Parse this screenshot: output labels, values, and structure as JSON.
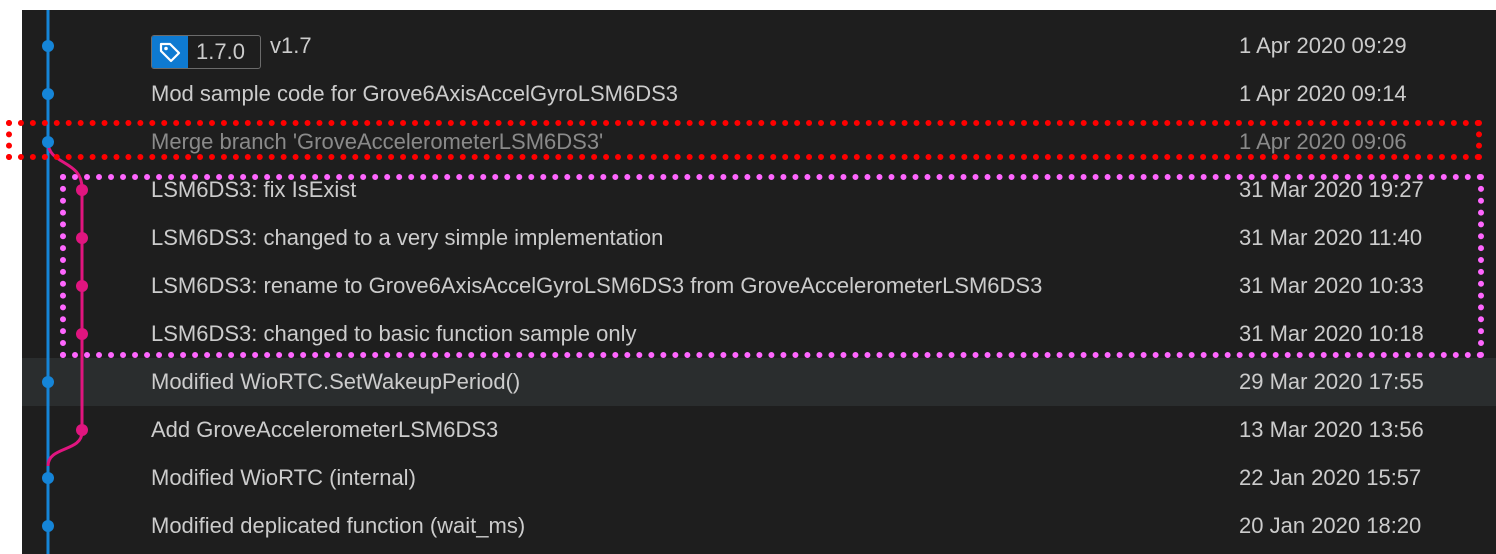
{
  "tag": {
    "name": "1.7.0",
    "label": "v1.7",
    "icon": "tag-icon"
  },
  "colors": {
    "main_branch": "#1585d8",
    "feature_branch": "#e0157f",
    "highlight_red": "#ff0000",
    "highlight_pink": "#ff66ff"
  },
  "commits": [
    {
      "message": "",
      "date": "1 Apr 2020 09:29"
    },
    {
      "message": "Mod sample code for Grove6AxisAccelGyroLSM6DS3",
      "date": "1 Apr 2020 09:14"
    },
    {
      "message": "Merge branch 'GroveAccelerometerLSM6DS3'",
      "date": "1 Apr 2020 09:06"
    },
    {
      "message": "LSM6DS3: fix IsExist",
      "date": "31 Mar 2020 19:27"
    },
    {
      "message": "LSM6DS3: changed to a very simple implementation",
      "date": "31 Mar 2020 11:40"
    },
    {
      "message": "LSM6DS3: rename to Grove6AxisAccelGyroLSM6DS3 from GroveAccelerometerLSM6DS3",
      "date": "31 Mar 2020 10:33"
    },
    {
      "message": "LSM6DS3: changed to basic function sample only",
      "date": "31 Mar 2020 10:18"
    },
    {
      "message": "Modified WioRTC.SetWakeupPeriod()",
      "date": "29 Mar 2020 17:55"
    },
    {
      "message": "Add GroveAccelerometerLSM6DS3",
      "date": "13 Mar 2020 13:56"
    },
    {
      "message": "Modified WioRTC (internal)",
      "date": "22 Jan 2020 15:57"
    },
    {
      "message": "Modified deplicated function (wait_ms)",
      "date": "20 Jan 2020 18:20"
    }
  ]
}
